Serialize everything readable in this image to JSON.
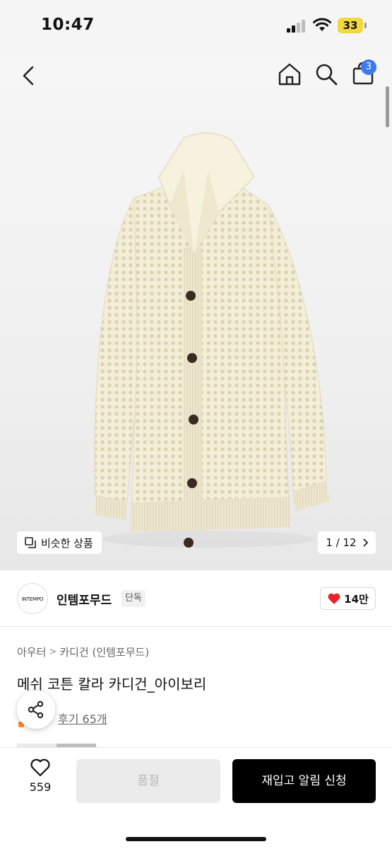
{
  "status_bar": {
    "time": "10:47",
    "battery": "33",
    "icons": [
      "signal-icon",
      "wifi-icon",
      "battery-icon"
    ]
  },
  "header": {
    "icons": [
      "back-icon",
      "home-icon",
      "search-icon",
      "cart-icon"
    ],
    "cart_count": "3"
  },
  "gallery": {
    "similar_label": "비슷한 상품",
    "page_indicator": "1 / 12"
  },
  "brand": {
    "logo_text": "INTEMPO",
    "name": "인템포무드",
    "badge": "단독",
    "likes": "14만"
  },
  "product": {
    "breadcrumb": [
      "아우터",
      "카디건 (인템포무드)"
    ],
    "title": "메쉬 코튼 칼라 카디건_아이보리",
    "review_label": "후기 65개"
  },
  "actions": {
    "wish_count": "559",
    "soldout_label": "품절",
    "restock_label": "재입고 알림 신청"
  },
  "colors": {
    "accent": "#3a7bf0",
    "heart": "#e8232d",
    "primary_button": "#000000",
    "disabled_button": "#ebebeb",
    "battery": "#f3d83a"
  }
}
